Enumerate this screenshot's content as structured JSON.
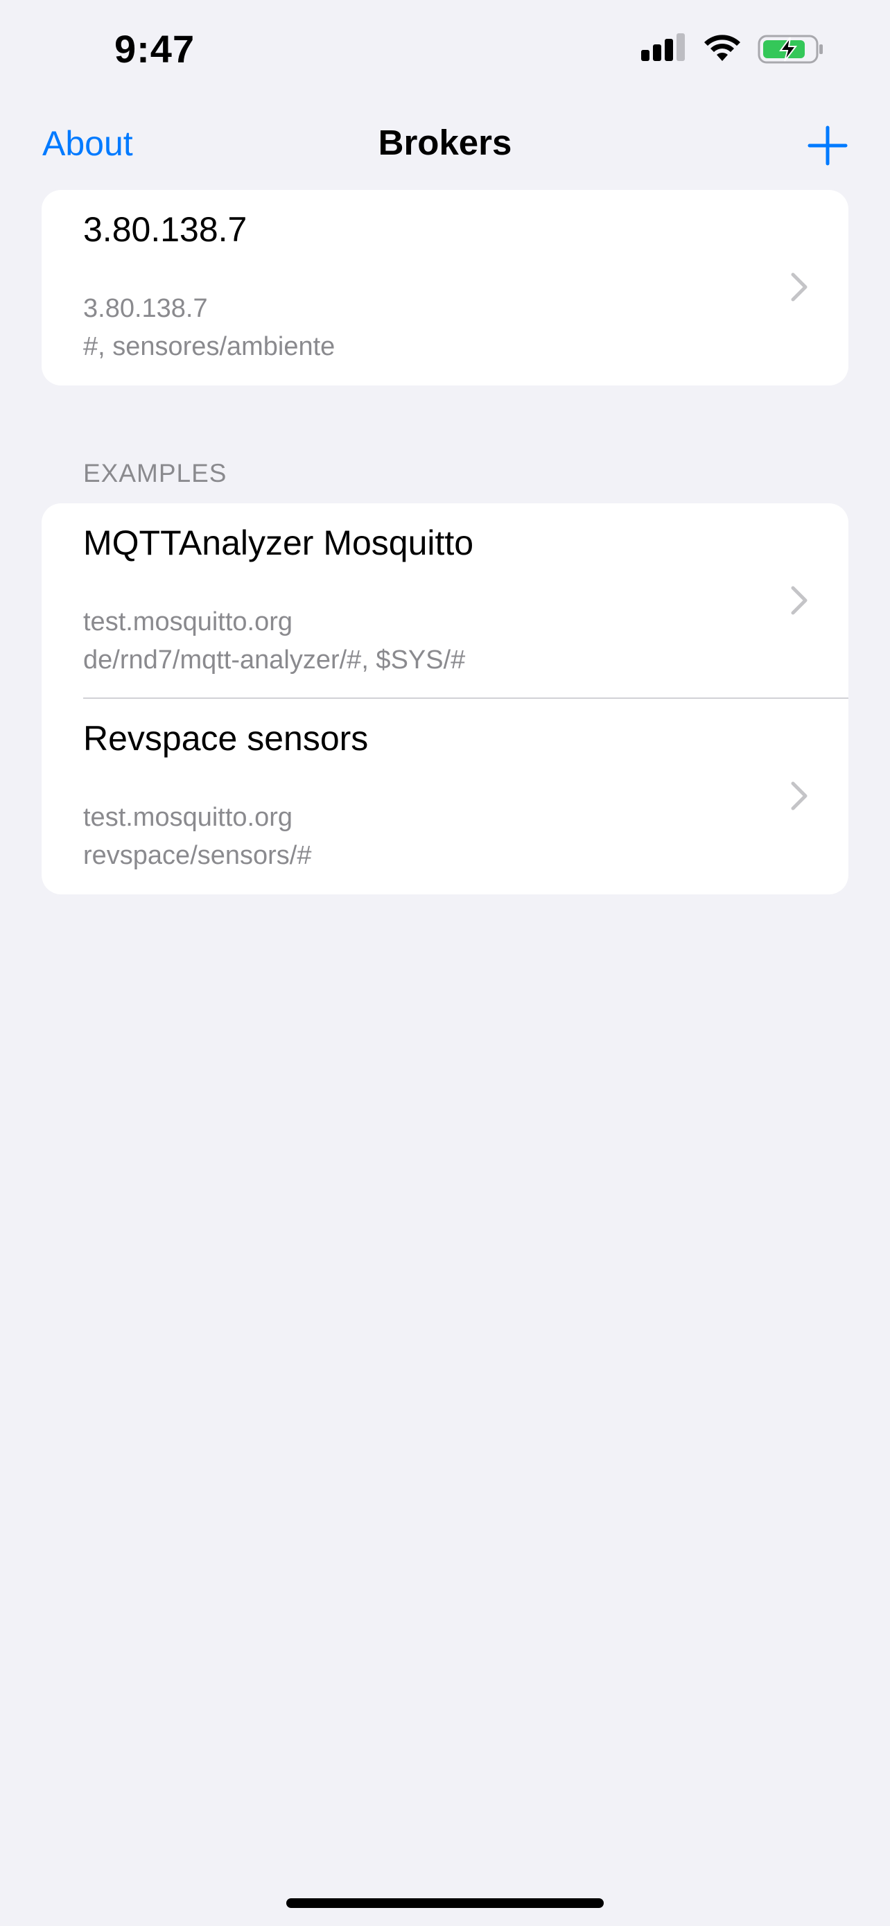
{
  "status_bar": {
    "time": "9:47"
  },
  "nav": {
    "back_label": "About",
    "title": "Brokers",
    "add_icon": "plus-icon",
    "accent_color": "#007AFF"
  },
  "brokers": [
    {
      "title": "3.80.138.7",
      "host": "3.80.138.7",
      "topics": "#, sensores/ambiente"
    }
  ],
  "examples": {
    "header": "EXAMPLES",
    "items": [
      {
        "title": "MQTTAnalyzer Mosquitto",
        "host": "test.mosquitto.org",
        "topics": "de/rnd7/mqtt-analyzer/#, $SYS/#"
      },
      {
        "title": "Revspace sensors",
        "host": "test.mosquitto.org",
        "topics": "revspace/sensors/#"
      }
    ]
  }
}
